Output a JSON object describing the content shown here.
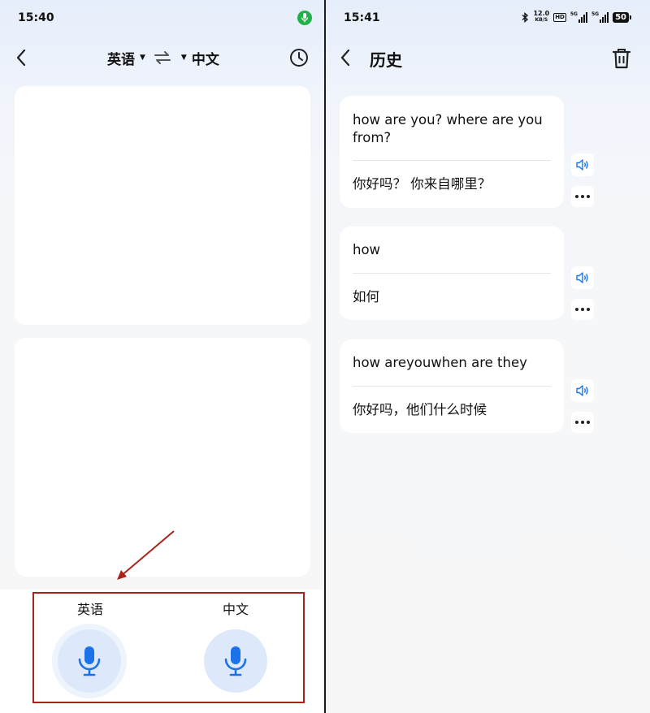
{
  "left": {
    "status": {
      "time": "15:40"
    },
    "lang_bar": {
      "source": "英语",
      "target": "中文"
    },
    "speak": {
      "english_label": "英语",
      "chinese_label": "中文"
    }
  },
  "right": {
    "status": {
      "time": "15:41",
      "net_speed": "12.0",
      "net_unit": "KB/S",
      "hd": "HD",
      "net_type_1": "5G",
      "net_type_2": "5G",
      "battery": "50"
    },
    "title": "历史",
    "history": [
      {
        "source": "how are you?  where are you from?",
        "target": "你好吗？ 你来自哪里？"
      },
      {
        "source": "how",
        "target": "如何"
      },
      {
        "source": "how areyouwhen are they",
        "target": "你好吗，他们什么时候"
      }
    ]
  },
  "colors": {
    "accent": "#1a73e8",
    "mic_active": "#21b14b",
    "annotation": "#a8241b"
  }
}
